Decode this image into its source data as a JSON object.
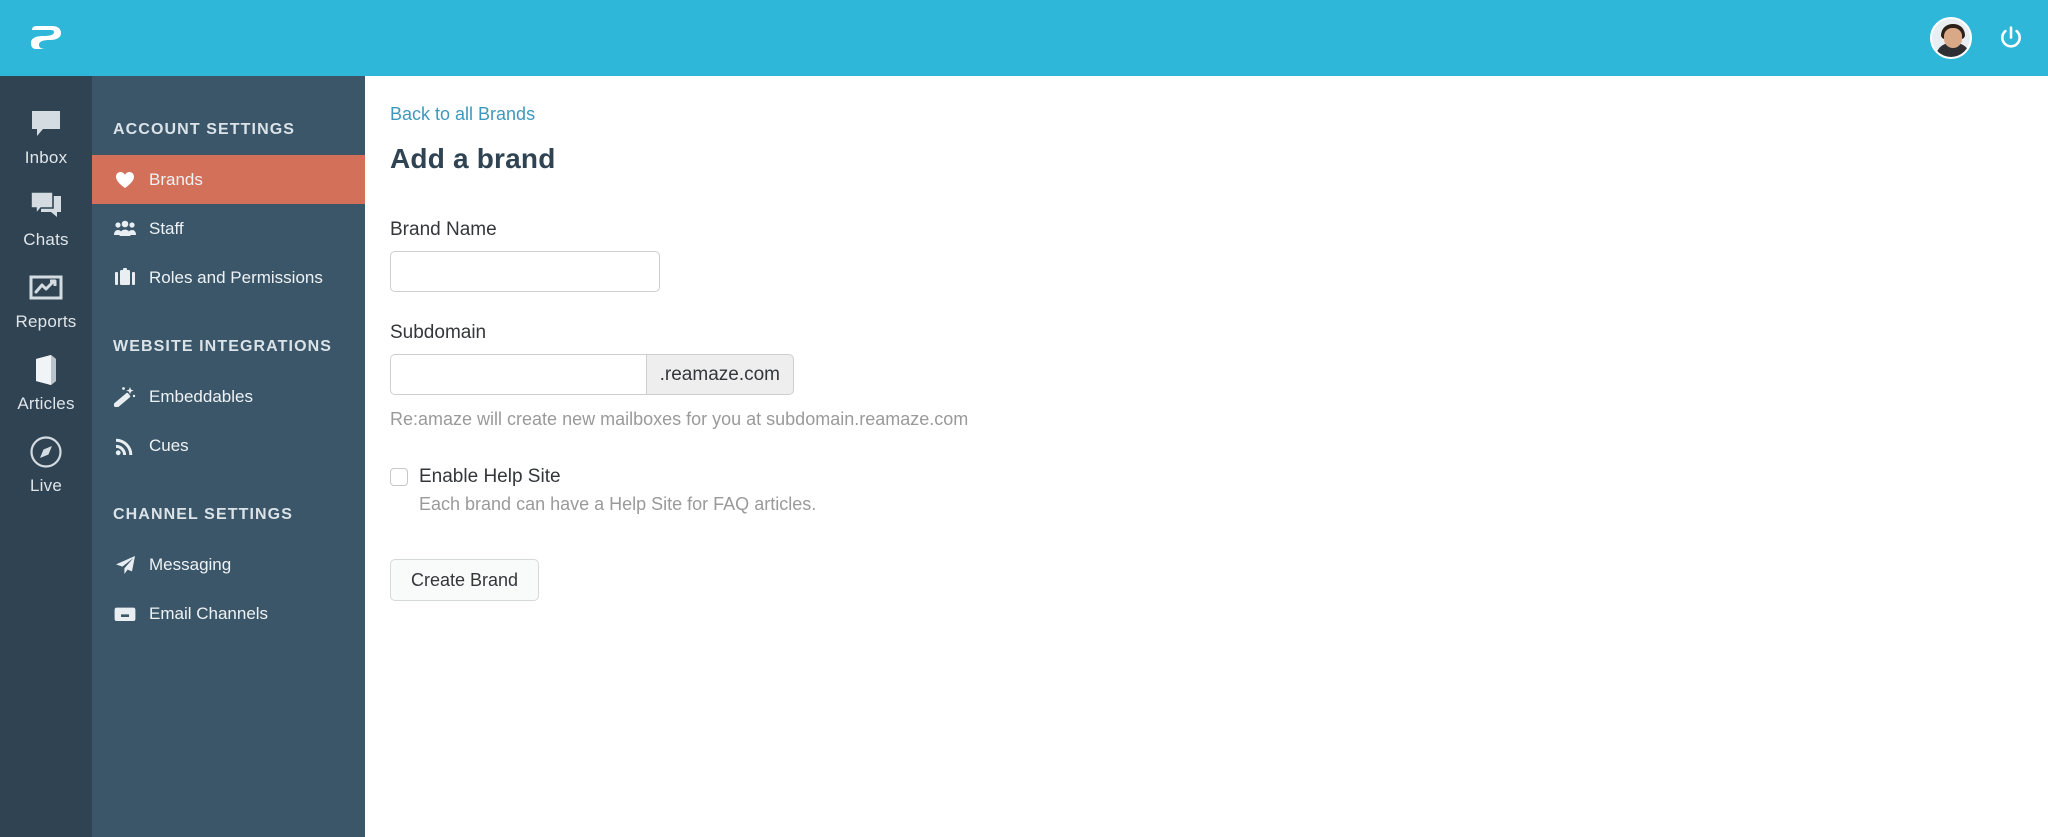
{
  "topbar": {
    "logo_name": "reamaze-leaf-logo",
    "background_color": "#2eb7d8",
    "avatar_alt": "User avatar",
    "logout_title": "Logout"
  },
  "rail": {
    "background_color": "#2f4352",
    "items": [
      {
        "label": "Inbox",
        "icon": "speech-bubble-icon"
      },
      {
        "label": "Chats",
        "icon": "double-speech-bubble-icon"
      },
      {
        "label": "Reports",
        "icon": "chart-frame-icon"
      },
      {
        "label": "Articles",
        "icon": "book-icon"
      },
      {
        "label": "Live",
        "icon": "compass-icon"
      }
    ]
  },
  "subnav": {
    "background_color": "#3a5668",
    "active_color": "#d2705a",
    "sections": [
      {
        "heading": "ACCOUNT SETTINGS",
        "items": [
          {
            "label": "Brands",
            "icon": "heart-icon",
            "active": true
          },
          {
            "label": "Staff",
            "icon": "people-icon",
            "active": false
          },
          {
            "label": "Roles and Permissions",
            "icon": "briefcase-icon",
            "active": false
          }
        ]
      },
      {
        "heading": "WEBSITE INTEGRATIONS",
        "items": [
          {
            "label": "Embeddables",
            "icon": "magic-wand-icon",
            "active": false
          },
          {
            "label": "Cues",
            "icon": "rss-signal-icon",
            "active": false
          }
        ]
      },
      {
        "heading": "CHANNEL SETTINGS",
        "items": [
          {
            "label": "Messaging",
            "icon": "paper-plane-icon",
            "active": false
          },
          {
            "label": "Email Channels",
            "icon": "inbox-tray-icon",
            "active": false
          }
        ]
      }
    ]
  },
  "main": {
    "back_link": "Back to all Brands",
    "title": "Add a brand",
    "brand_name": {
      "label": "Brand Name",
      "value": "",
      "placeholder": ""
    },
    "subdomain": {
      "label": "Subdomain",
      "value": "",
      "placeholder": "",
      "addon": ".reamaze.com",
      "helper": "Re:amaze will create new mailboxes for you at subdomain.reamaze.com"
    },
    "help_site": {
      "label": "Enable Help Site",
      "checked": false,
      "description": "Each brand can have a Help Site for FAQ articles."
    },
    "submit_label": "Create Brand"
  }
}
